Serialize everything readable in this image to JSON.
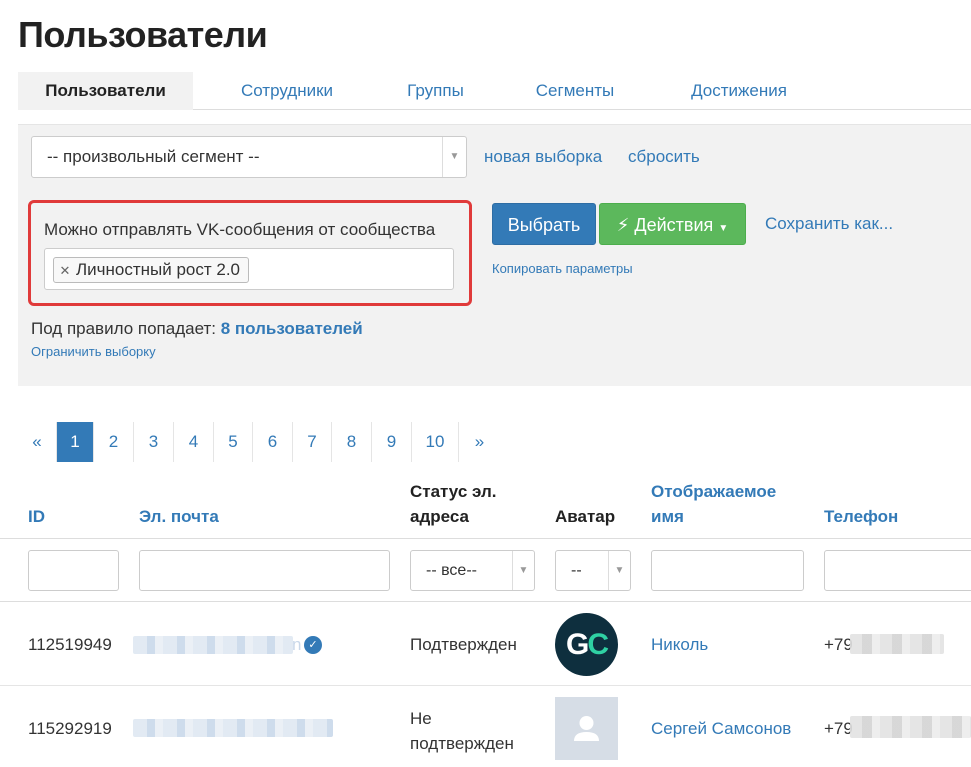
{
  "page_title": "Пользователи",
  "tabs": [
    {
      "label": "Пользователи",
      "active": true
    },
    {
      "label": "Сотрудники",
      "active": false
    },
    {
      "label": "Группы",
      "active": false
    },
    {
      "label": "Сегменты",
      "active": false
    },
    {
      "label": "Достижения",
      "active": false
    }
  ],
  "filter": {
    "segment_select": "-- произвольный сегмент --",
    "new_selection_link": "новая выборка",
    "reset_link": "сбросить",
    "rule_label": "Можно отправлять VK-сообщения от сообщества",
    "rule_tag": "Личностный рост 2.0",
    "select_button": "Выбрать",
    "actions_button": "Действия",
    "save_as_link": "Сохранить как...",
    "copy_params_link": "Копировать параметры",
    "match_prefix": "Под правило попадает:",
    "match_count": "8 пользователей",
    "limit_link": "Ограничить выборку"
  },
  "pagination": {
    "prev": "«",
    "pages": [
      "1",
      "2",
      "3",
      "4",
      "5",
      "6",
      "7",
      "8",
      "9",
      "10"
    ],
    "active": "1",
    "next": "»"
  },
  "table": {
    "headers": {
      "id": "ID",
      "email": "Эл. почта",
      "email_status_1": "Статус эл.",
      "email_status_2": "адреса",
      "avatar": "Аватар",
      "display_name_1": "Отображаемое",
      "display_name_2": "имя",
      "phone": "Телефон"
    },
    "filters": {
      "email_status": "-- все--",
      "avatar": "--"
    },
    "rows": [
      {
        "id": "112519949",
        "email_visible_end": "n",
        "status": "Подтвержден",
        "avatar": "GC",
        "name": "Николь",
        "phone_prefix": "+79"
      },
      {
        "id": "115292919",
        "status_1": "Не",
        "status_2": "подтвержден",
        "name": "Сергей Самсонов",
        "phone_prefix": "+79"
      }
    ]
  },
  "colors": {
    "accent": "#337ab7",
    "green": "#5cb85c",
    "highlight": "#e03a3a",
    "panel": "#f2f2f2"
  }
}
